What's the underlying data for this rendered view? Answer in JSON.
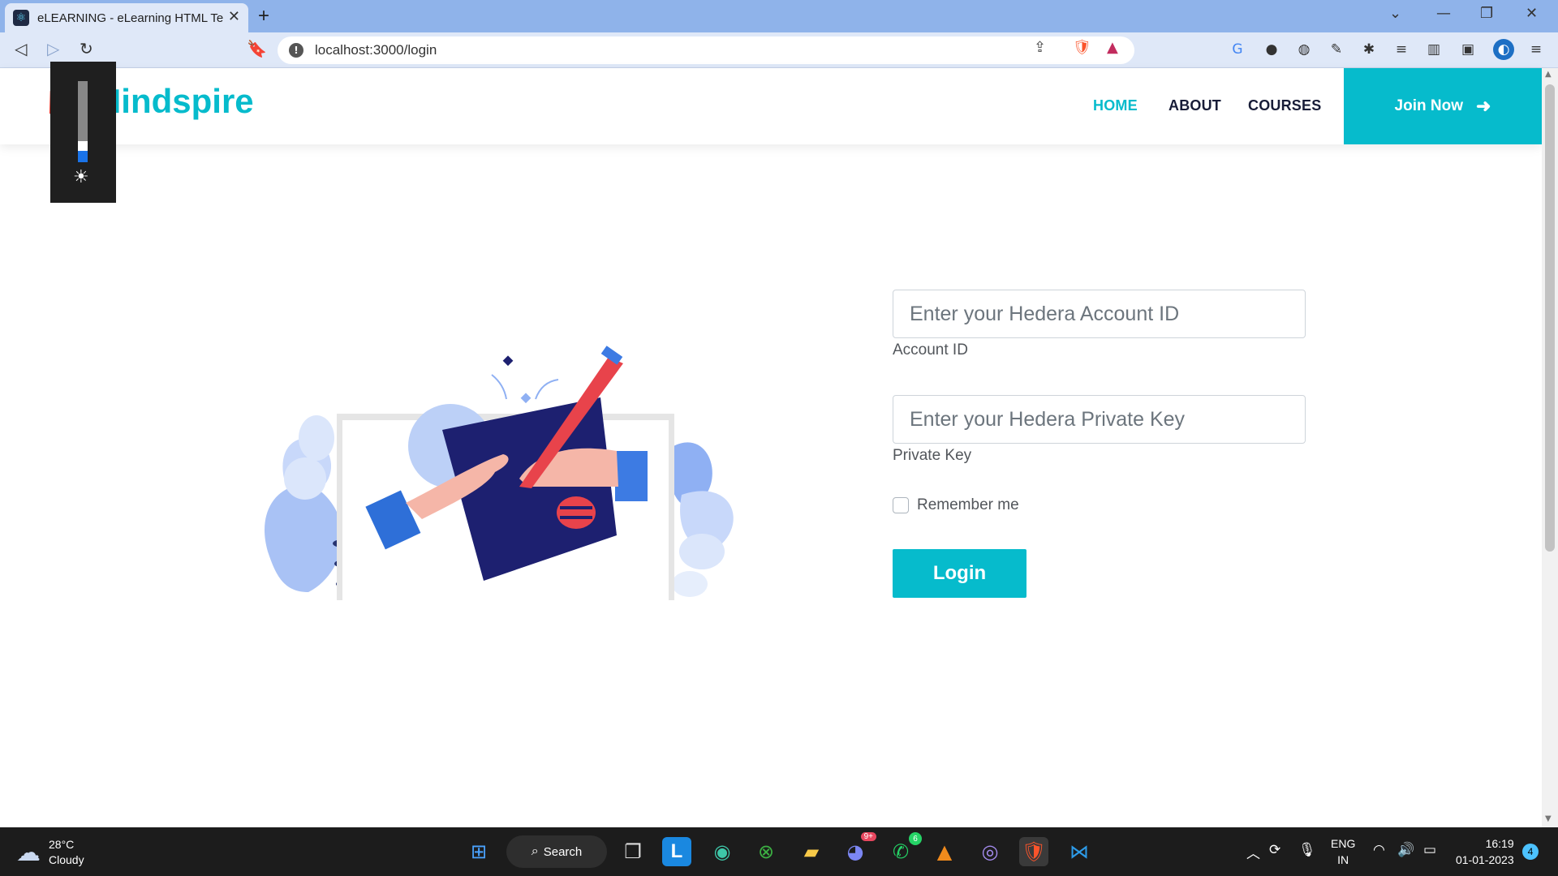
{
  "browser": {
    "tab_title": "eLEARNING - eLearning HTML Te",
    "new_tab_symbol": "+",
    "url": "localhost:3000/login"
  },
  "site": {
    "brand": "Mindspire",
    "nav": [
      {
        "label": "HOME",
        "active": true
      },
      {
        "label": "ABOUT",
        "active": false
      },
      {
        "label": "COURSES",
        "active": false
      }
    ],
    "join_label": "Join Now",
    "accent_color": "#06bbcc"
  },
  "form": {
    "account_placeholder": "Enter your Hedera Account ID",
    "account_label": "Account ID",
    "key_placeholder": "Enter your Hedera Private Key",
    "key_label": "Private Key",
    "remember_label": "Remember me",
    "login_label": "Login"
  },
  "taskbar": {
    "temperature": "28°C",
    "weather": "Cloudy",
    "search_label": "Search",
    "discord_badge": "9+",
    "whatsapp_badge": "6",
    "lang_line1": "ENG",
    "lang_line2": "IN",
    "time": "16:19",
    "date": "01-01-2023",
    "notifications": "4"
  }
}
